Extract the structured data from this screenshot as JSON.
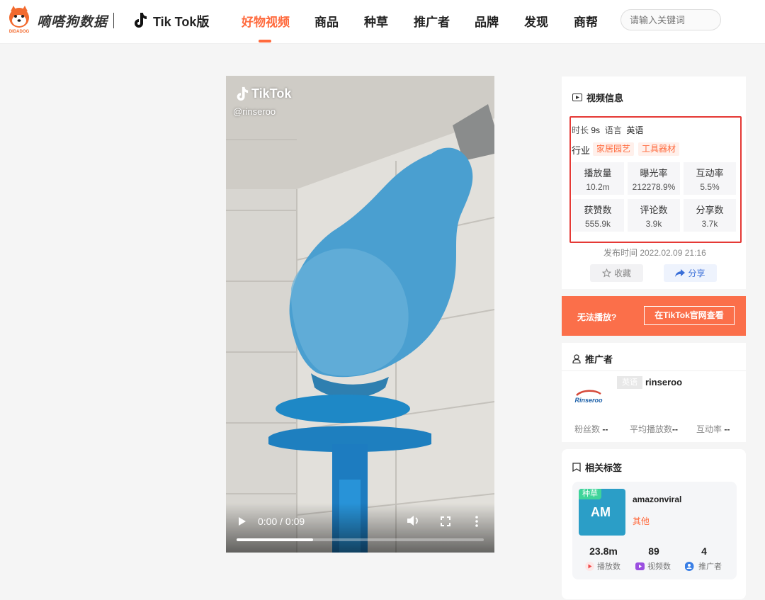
{
  "header": {
    "brand": "嘀嗒狗数据",
    "logo_caption": "DIDADOG",
    "version": "Tik Tok版",
    "nav": [
      "好物视频",
      "商品",
      "种草",
      "推广者",
      "品牌",
      "发现",
      "商帮"
    ],
    "active_nav": "好物视频",
    "search_placeholder": "请输入关键词"
  },
  "video": {
    "watermark": "TikTok",
    "handle": "@rinseroo",
    "time": "0:00 / 0:09",
    "progress": 0.31
  },
  "video_info": {
    "title": "视频信息",
    "duration_label": "时长",
    "duration": "9s",
    "language_label": "语言",
    "language": "英语",
    "industry_label": "行业",
    "industries": [
      "家居园艺",
      "工具器材"
    ],
    "stats": [
      {
        "label": "播放量",
        "value": "10.2m"
      },
      {
        "label": "曝光率",
        "value": "212278.9%"
      },
      {
        "label": "互动率",
        "value": "5.5%"
      },
      {
        "label": "获赞数",
        "value": "555.9k"
      },
      {
        "label": "评论数",
        "value": "3.9k"
      },
      {
        "label": "分享数",
        "value": "3.7k"
      }
    ],
    "publish_time": "发布时间 2022.02.09 21:16",
    "favorite": "收藏",
    "share": "分享"
  },
  "banner": {
    "text": "无法播放?",
    "button": "在TikTok官网查看"
  },
  "promoter": {
    "title": "推广者",
    "lang_badge": "英语",
    "name": "rinseroo",
    "avatar_text": "Rinseroo",
    "stats": [
      {
        "label": "粉丝数",
        "value": "--"
      },
      {
        "label": "平均播放数",
        "value": "--"
      },
      {
        "label": "互动率",
        "value": "--"
      }
    ]
  },
  "related_tags": {
    "title": "相关标签",
    "badge": "种草",
    "tile_text": "AM",
    "name": "amazonviral",
    "category": "其他",
    "stats": [
      {
        "value": "23.8m",
        "label": "播放数",
        "color": "#f04848"
      },
      {
        "value": "89",
        "label": "视频数",
        "color": "#9b4fe0"
      },
      {
        "value": "4",
        "label": "推广者",
        "color": "#3a7fe6"
      }
    ]
  }
}
